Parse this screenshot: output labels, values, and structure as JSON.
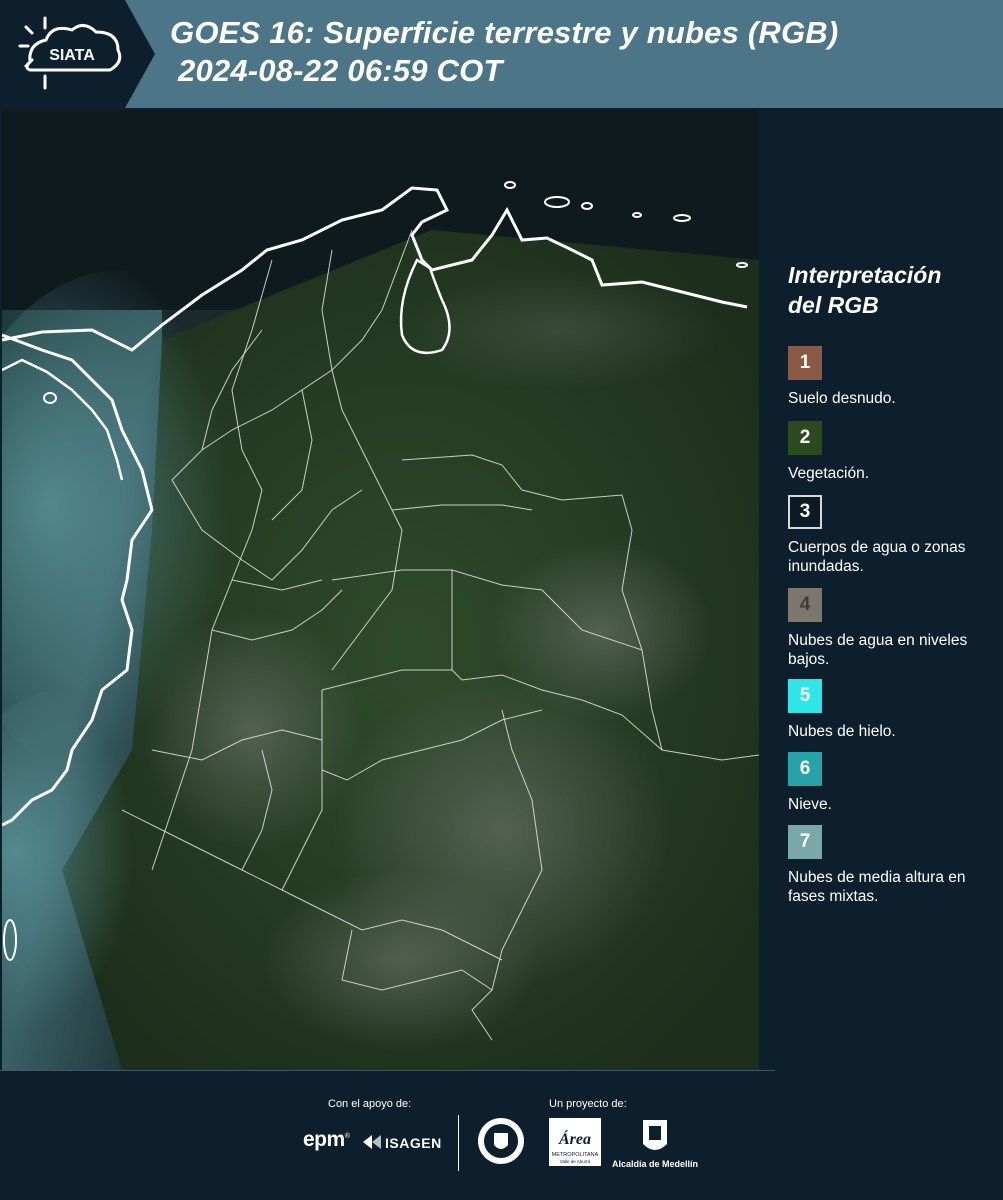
{
  "header": {
    "logo_text": "SIATA",
    "title_line1": "GOES 16: Superficie terrestre y nubes (RGB)",
    "title_line2": "2024-08-22 06:59 COT",
    "background": "#4c7587"
  },
  "legend": {
    "title_line1": "Interpretación",
    "title_line2": "del RGB",
    "items": [
      {
        "number": "1",
        "label": "Suelo desnudo.",
        "color": "#8a5a44"
      },
      {
        "number": "2",
        "label": "Vegetación.",
        "color": "#2d4a1f"
      },
      {
        "number": "3",
        "label": "Cuerpos de agua o zonas inundadas.",
        "color": "#0b1a24"
      },
      {
        "number": "4",
        "label": "Nubes de agua en niveles bajos.",
        "color": "#7d766c"
      },
      {
        "number": "5",
        "label": "Nubes de hielo.",
        "color": "#2ee6e6"
      },
      {
        "number": "6",
        "label": "Nieve.",
        "color": "#25a3a6"
      },
      {
        "number": "7",
        "label": "Nubes de media altura en fases mixtas.",
        "color": "#7aa7a7"
      }
    ]
  },
  "footer": {
    "support_label": "Con el apoyo de:",
    "project_label": "Un proyecto de:",
    "epm_text": "epm",
    "isagen_text": "ISAGEN",
    "area_text_1": "Área",
    "area_text_2": "METROPOLITANA",
    "area_text_3": "Valle de Aburrá",
    "alcaldia_text": "Alcaldía de Medellín"
  }
}
